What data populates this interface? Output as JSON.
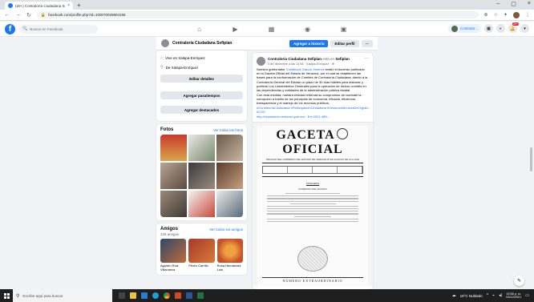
{
  "browser": {
    "tab_title": "(20+) Contraloría Ciudadana Se",
    "tab_close": "×",
    "new_tab": "+",
    "window_controls": [
      "–",
      "▢",
      "×"
    ],
    "url": "facebook.com/profile.php?id=100070025804156"
  },
  "facebook": {
    "logo": "f",
    "search_placeholder": "Buscar en Facebook",
    "profile_chip": "Contralor...",
    "notif_count": "20+"
  },
  "page_header": {
    "name": "Contraloría Ciudadana Sefiplan",
    "add_story": "Agregar a historia",
    "edit_profile": "Editar perfil",
    "more": "···"
  },
  "intro": {
    "lives_in": "Vive en Xalapa-Enríquez",
    "from": "De Xalapa-Enríquez",
    "edit_details": "Editar detalles",
    "add_hobbies": "Agregar pasatiempos",
    "add_featured": "Agregar destacados"
  },
  "photos": {
    "title": "Fotos",
    "see_all": "Ver todas las fotos"
  },
  "friends": {
    "title": "Amigos",
    "count": "226 amigos",
    "see_all": "Ver todos los amigos",
    "items": [
      {
        "name": "Agustín Ruiz Villanueva"
      },
      {
        "name": "Pedro Carrillo"
      },
      {
        "name": "Rosa Hernández Luis"
      }
    ]
  },
  "post": {
    "author": "Contraloría Ciudadana Sefiplan",
    "action": "está en",
    "target": "Sefiplan",
    "meta": "3 de diciembre a las 13:58 · Xalapa-Enríquez · ⊕",
    "more": "···",
    "text_1a": "Nuestro gobernador ",
    "text_1b": "Cuitláhuac García Jiménez",
    "text_1c": " emitió el Acuerdo publicado en la Gaceta Oficial del Estado de Veracruz, por el cual se establecen las bases para la conformación de Comités de Contraloría Ciudadana; dando a la Contraloría General del Estado un plazo de 30 días hábiles para elaborar y publicar Los Lineamientos Generales para la operación de dichos comités en las dependencias y entidades de la administración pública estatal.",
    "text_2": "Con esta medida, nuestra entidad refrenda su compromiso de combatir la corrupción a través de los principios de economía, eficacia, eficiencia, transparencia y el manejo de los recursos públicos.",
    "hashtags": "#ContraloríaCiudadana #ParticipaciónCiudadana #VeracruzMeLlenaDeOrgullo #CGE",
    "link": "http://repositorio.veracruz.gob.mx/...Ext.2021-485..."
  },
  "gaceta": {
    "title_left": "GACETA",
    "title_right": "OFICIAL",
    "subtitle": "ÓRGANO DEL GOBIERNO DEL ESTADO DE VERACRUZ DE IGNACIO DE LA LLAVE",
    "summary": "SUMARIO",
    "gov": "GOBIERNO DEL ESTADO",
    "bottom": "NÚMERO EXTRAORDINARIO"
  },
  "taskbar": {
    "search_placeholder": "Escribe aquí para buscar",
    "weather": "18°C Nublado",
    "time": "13:58 p. m.",
    "date": "03/12/2021"
  },
  "colors": {
    "facebook_blue": "#1877f2",
    "page_bg": "#f0f2f5",
    "taskbar": "#1f1f1f"
  }
}
